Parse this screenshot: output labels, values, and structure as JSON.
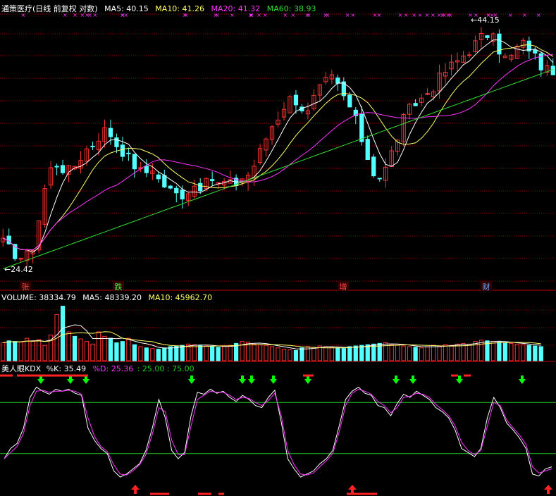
{
  "price_panel": {
    "title": "通策医疗(日线 前复权 对数)",
    "ma5_label": "MA5: 40.15",
    "ma10_label": "MA10: 41.26",
    "ma20_label": "MA20: 41.32",
    "ma60_label": "MA60: 38.93",
    "high_annotation": "44.15",
    "low_annotation": "24.42",
    "event_labels": [
      "张",
      "跌",
      "增",
      "财"
    ]
  },
  "volume_panel": {
    "vol_label": "VOLUME: 38334.79",
    "ma5_label": "MA5: 48339.20",
    "ma10_label": "MA10: 45962.70"
  },
  "kdx_panel": {
    "title": "美人眼KDX",
    "k_label": "%K: 35.49",
    "d_label": "%D: 25.36",
    "level_labels": ": 25.00 : 75.00"
  },
  "colors": {
    "up": "#ff3232",
    "down": "#54ffff",
    "ma5": "#ffffff",
    "ma10": "#ffff66",
    "ma20": "#ff33ff",
    "ma60": "#33dd33",
    "grid": "#990000",
    "k_line": "#ffffff",
    "d_line": "#ff33ff",
    "level_line": "#22cc22",
    "sell_marker": "#00ff00",
    "buy_marker": "#ff2222"
  },
  "chart_data": [
    {
      "type": "candlestick",
      "title": "通策医疗(日线 前复权 对数)",
      "scale": "log",
      "annotated_high": 44.15,
      "annotated_low": 24.42,
      "series": [
        {
          "name": "MA5",
          "last": 40.15
        },
        {
          "name": "MA10",
          "last": 41.26
        },
        {
          "name": "MA20",
          "last": 41.32
        },
        {
          "name": "MA60",
          "last": 38.93
        }
      ],
      "close_path": [
        25.5,
        25.0,
        24.6,
        24.5,
        25.2,
        27.5,
        30.5,
        31.5,
        31.0,
        30.8,
        31.5,
        32.5,
        33.0,
        33.8,
        34.5,
        33.2,
        32.5,
        31.8,
        31.0,
        30.5,
        31.2,
        30.0,
        29.5,
        29.0,
        28.9,
        29.3,
        29.8,
        29.5,
        30.2,
        29.7,
        29.9,
        29.6,
        30.2,
        30.5,
        31.5,
        33.0,
        34.5,
        35.5,
        36.8,
        37.5,
        36.5,
        35.8,
        37.5,
        38.5,
        39.5,
        38.6,
        37.2,
        36.0,
        34.0,
        32.0,
        30.5,
        30.2,
        31.8,
        33.5,
        35.5,
        36.5,
        37.0,
        37.8,
        38.5,
        39.6,
        40.4,
        41.0,
        41.8,
        42.5,
        43.5,
        44.2,
        43.5,
        42.0,
        41.0,
        42.5,
        43.0,
        42.5,
        41.0,
        40.0,
        40.2
      ]
    },
    {
      "type": "bar",
      "title": "VOLUME",
      "series": [
        {
          "name": "VOLUME",
          "last": 38334.79
        },
        {
          "name": "MA5",
          "last": 48339.2
        },
        {
          "name": "MA10",
          "last": 45962.7
        }
      ],
      "values": [
        28,
        31,
        30,
        29,
        35,
        30,
        33,
        24,
        40,
        72,
        85,
        45,
        38,
        34,
        30,
        26,
        45,
        38,
        35,
        28,
        30,
        35,
        25,
        22,
        20,
        19,
        18,
        20,
        22,
        23,
        24,
        26,
        25,
        24,
        23,
        22,
        21,
        22,
        24,
        27,
        30,
        29,
        26,
        25,
        24,
        22,
        20,
        18,
        17,
        16,
        20,
        22,
        21,
        23,
        22,
        21,
        20,
        19,
        22,
        23,
        24,
        25,
        26,
        27,
        28,
        25,
        24,
        23,
        22,
        21,
        20,
        22,
        24,
        23,
        25,
        24,
        26,
        27,
        26,
        30,
        32,
        31,
        30,
        29,
        28,
        27,
        26,
        25,
        24,
        23,
        22
      ]
    },
    {
      "type": "line",
      "title": "美人眼KDX",
      "levels": [
        25,
        75
      ],
      "ylim": [
        0,
        100
      ],
      "series": [
        {
          "name": "%K",
          "last": 35.49,
          "path": [
            20,
            30,
            35,
            50,
            80,
            90,
            86,
            83,
            88,
            86,
            88,
            84,
            82,
            50,
            38,
            30,
            25,
            8,
            2,
            5,
            10,
            15,
            28,
            50,
            78,
            60,
            28,
            20,
            26,
            62,
            85,
            83,
            88,
            84,
            86,
            80,
            76,
            82,
            78,
            72,
            70,
            80,
            87,
            56,
            20,
            10,
            2,
            5,
            8,
            15,
            20,
            28,
            52,
            78,
            86,
            90,
            84,
            82,
            72,
            70,
            62,
            74,
            83,
            80,
            86,
            82,
            78,
            70,
            66,
            60,
            48,
            30,
            26,
            22,
            30,
            60,
            80,
            70,
            55,
            48,
            40,
            30,
            5,
            3,
            10,
            12
          ]
        },
        {
          "name": "%D",
          "last": 25.36,
          "path": [
            20,
            26,
            32,
            45,
            72,
            86,
            87,
            85,
            86,
            86,
            87,
            86,
            83,
            60,
            42,
            32,
            27,
            14,
            5,
            4,
            8,
            14,
            24,
            44,
            70,
            66,
            38,
            24,
            24,
            52,
            78,
            82,
            86,
            85,
            85,
            82,
            78,
            80,
            79,
            75,
            72,
            77,
            84,
            62,
            28,
            14,
            5,
            4,
            6,
            12,
            18,
            25,
            46,
            72,
            84,
            88,
            86,
            83,
            76,
            72,
            65,
            70,
            80,
            81,
            84,
            83,
            80,
            73,
            68,
            62,
            52,
            36,
            28,
            24,
            28,
            52,
            75,
            72,
            58,
            50,
            43,
            34,
            12,
            6,
            8,
            10
          ]
        }
      ]
    }
  ]
}
